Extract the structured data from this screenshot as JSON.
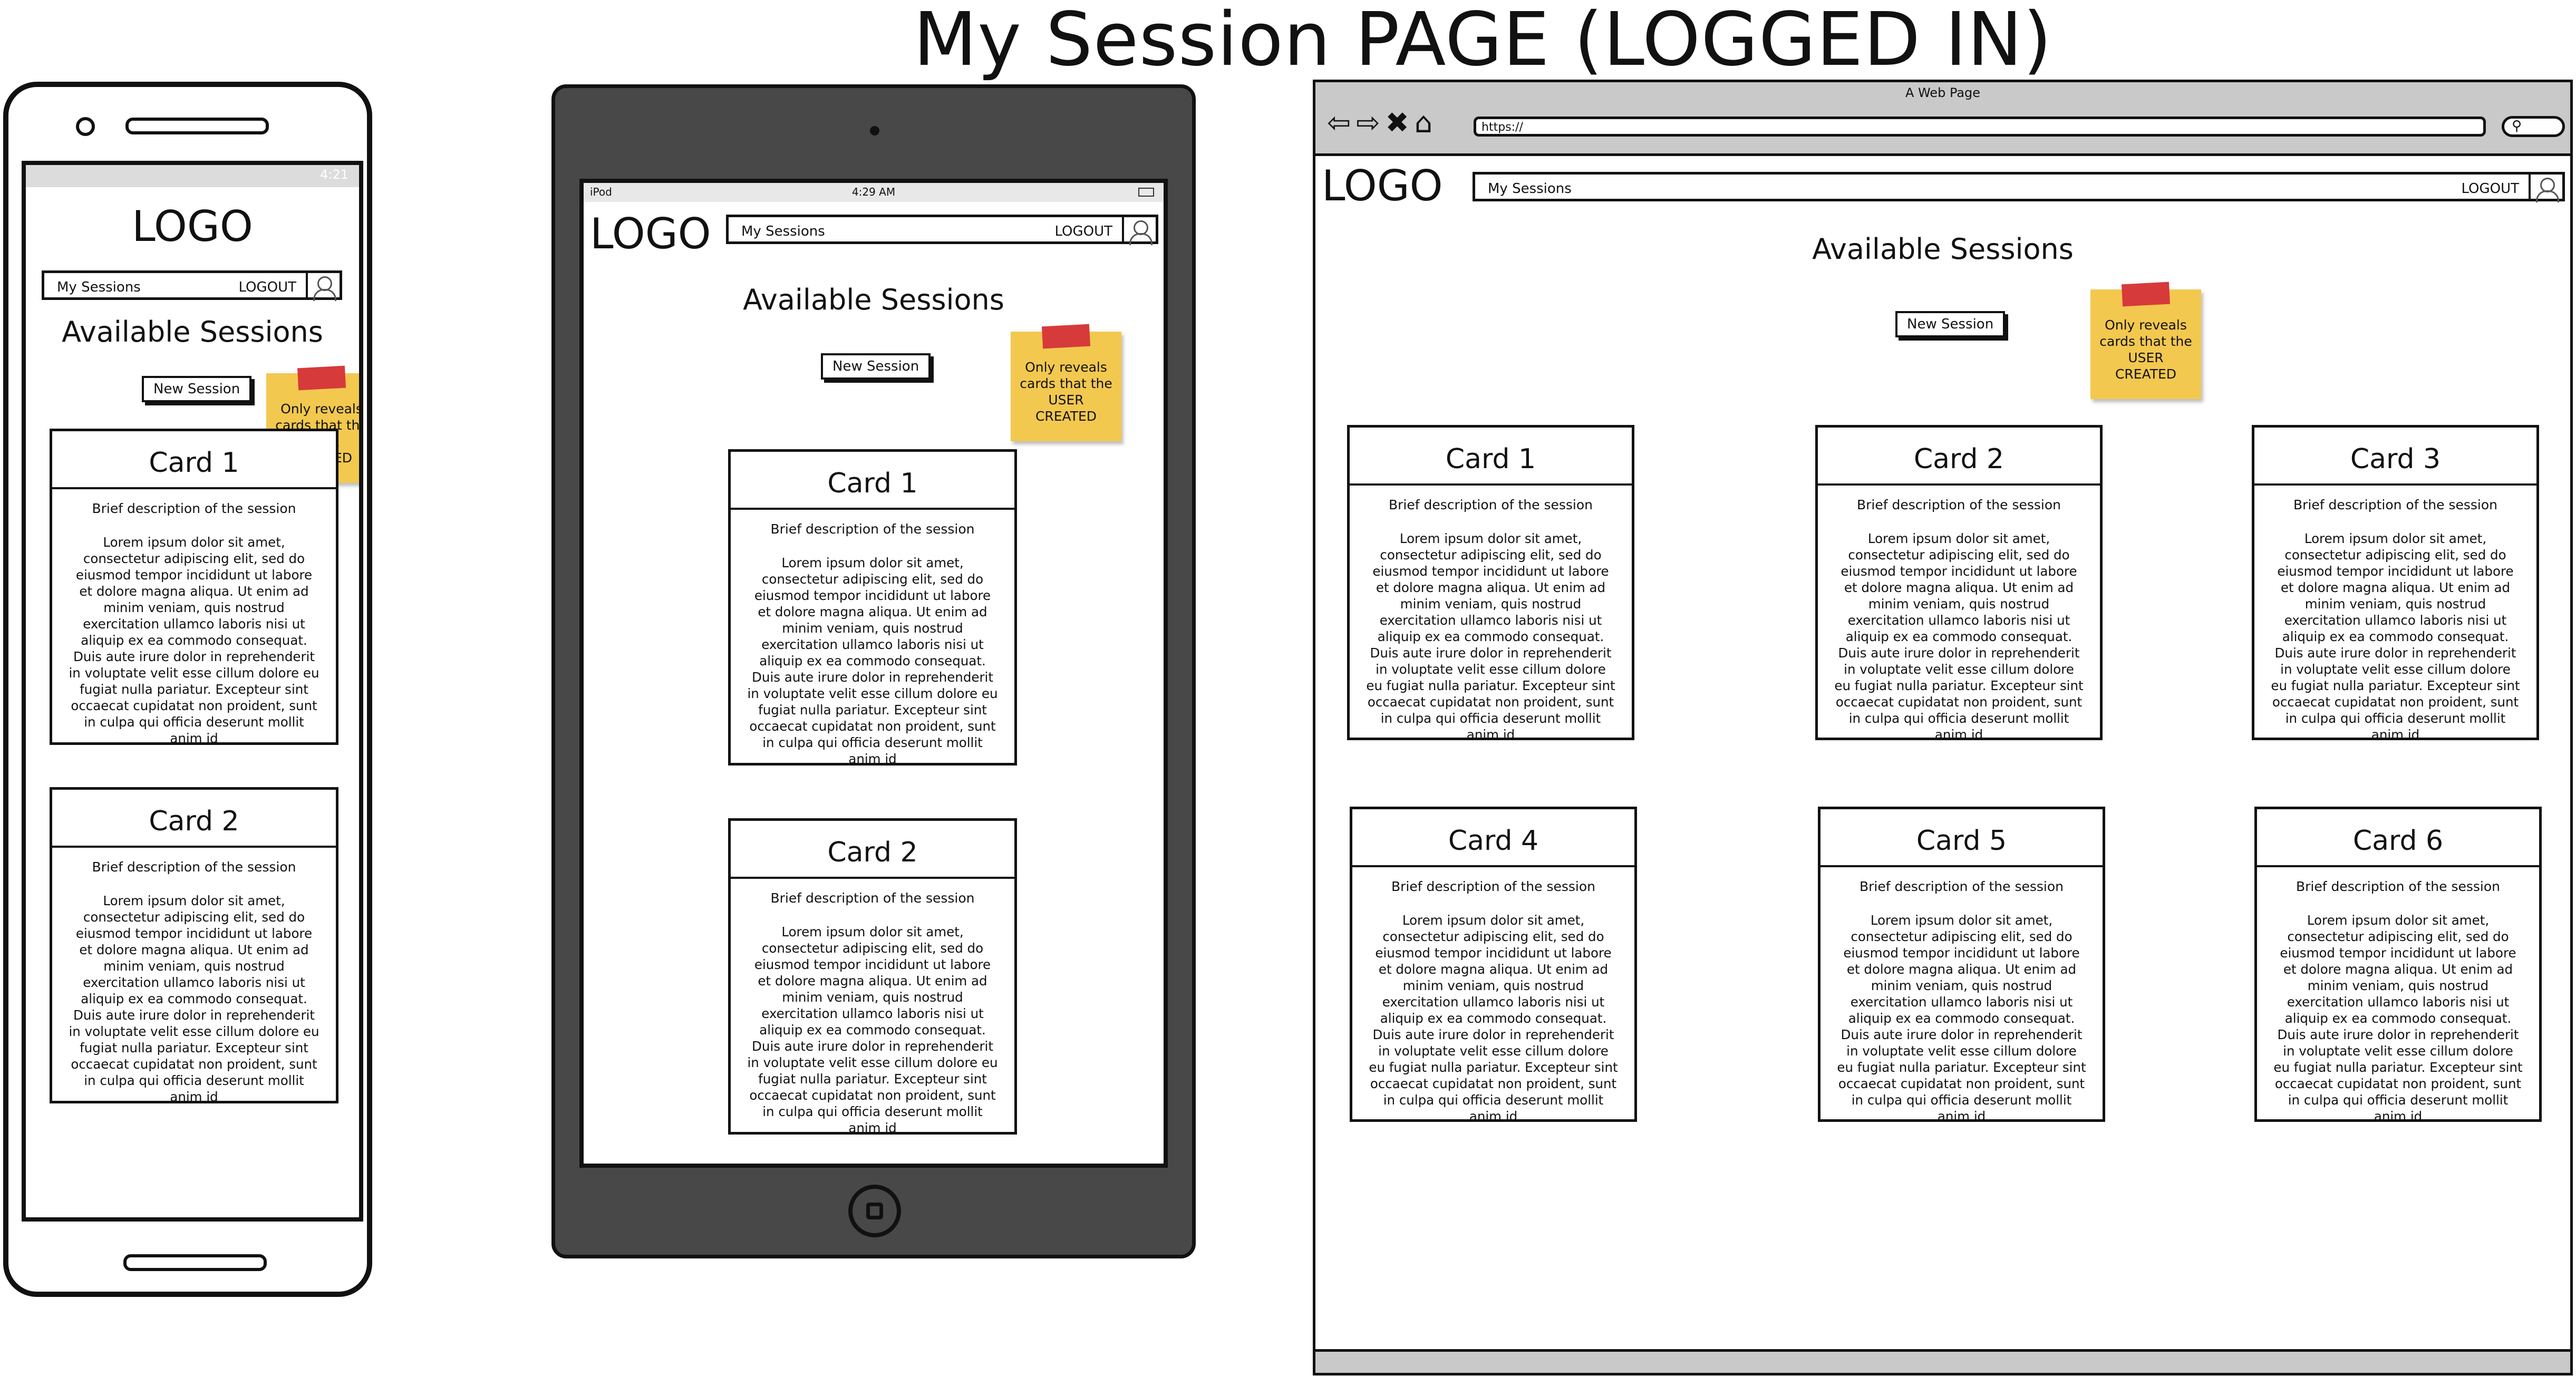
{
  "page_title": "My Session PAGE (LOGGED IN)",
  "logo": "LOGO",
  "nav": {
    "tab": "My Sessions",
    "logout": "LOGOUT"
  },
  "heading": "Available Sessions",
  "new_session_label": "New Session",
  "sticky_note": "Only reveals cards that the USER CREATED",
  "card_description": "Brief description of the session",
  "lorem": "Lorem ipsum dolor sit amet, consectetur adipiscing elit, sed do eiusmod tempor incididunt ut labore et dolore magna aliqua. Ut enim ad minim veniam, quis nostrud exercitation ullamco laboris nisi ut aliquip ex ea commodo consequat. Duis aute irure dolor in reprehenderit in voluptate velit esse cillum dolore eu fugiat nulla pariatur. Excepteur sint occaecat cupidatat non proident, sunt in culpa qui officia deserunt mollit anim id",
  "cards": [
    {
      "title": "Card 1"
    },
    {
      "title": "Card 2"
    },
    {
      "title": "Card 3"
    },
    {
      "title": "Card 4"
    },
    {
      "title": "Card 5"
    },
    {
      "title": "Card 6"
    }
  ],
  "phone": {
    "status_time": "4:21"
  },
  "tablet": {
    "carrier": "iPod",
    "status_time": "4:29 AM"
  },
  "browser": {
    "window_title": "A Web Page",
    "url": "https://",
    "nav_icons": [
      "back-arrow-icon",
      "forward-arrow-icon",
      "close-x-icon",
      "home-icon"
    ],
    "chrome_color": "#c9c9c9"
  },
  "colors": {
    "sticky_note": "#f3c84f",
    "tape": "#d73a3a",
    "tablet_frame": "#484848"
  }
}
